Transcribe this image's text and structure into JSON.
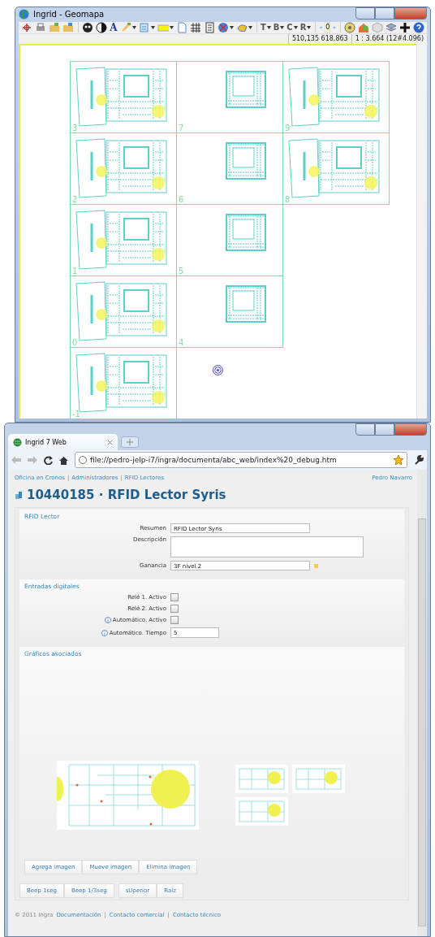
{
  "geomapa_window": {
    "title": "Ingrid - Geomapa",
    "toolbar": {
      "style_letter": "A",
      "letter_tools": [
        {
          "label": "T"
        },
        {
          "label": "B"
        },
        {
          "label": "C"
        },
        {
          "label": "R"
        }
      ],
      "page": "0"
    },
    "status": {
      "coordinates": "510,135  618,863",
      "scale": "1 : 3.664 (12#4.096)"
    },
    "map": {
      "rows": [
        [
          {
            "label": "3",
            "kind": "full"
          },
          {
            "label": "7",
            "kind": "core"
          },
          {
            "label": "9",
            "kind": "full"
          }
        ],
        [
          {
            "label": "2",
            "kind": "full"
          },
          {
            "label": "6",
            "kind": "core"
          },
          {
            "label": "8",
            "kind": "full"
          }
        ],
        [
          {
            "label": "1",
            "kind": "full"
          },
          {
            "label": "5",
            "kind": "core"
          }
        ],
        [
          {
            "label": "0",
            "kind": "full"
          },
          {
            "label": "4",
            "kind": "core"
          }
        ],
        [
          {
            "label": "-1",
            "kind": "full"
          }
        ]
      ]
    }
  },
  "browser_window": {
    "tab": {
      "title": "Ingrid 7 Web"
    },
    "url": "file://pedro-jelp-i7/ingra/documenta/abc_web/index%20_debug.htm",
    "page": {
      "breadcrumb": [
        "Oficina en Cronos",
        "Administradores",
        "RFID Lectores"
      ],
      "breadcrumb_separator": "|",
      "user": "Pedro Navarro",
      "heading": "10440185 · RFID Lector Syris",
      "sections": [
        {
          "title": "RFID Lector",
          "fields": [
            {
              "kind": "text",
              "label": "Resumen",
              "value": "RFID Lector Syris",
              "info": false
            },
            {
              "kind": "textarea",
              "label": "Descripción",
              "info": false
            },
            {
              "kind": "text",
              "label": "Ganancia",
              "value": "3F nivel 2",
              "info": false,
              "marked": true
            }
          ]
        },
        {
          "title": "Entradas digitales",
          "fields": [
            {
              "kind": "checkbox",
              "label": "Relé 1. Activo",
              "checked": false,
              "info": false
            },
            {
              "kind": "checkbox",
              "label": "Relé 2. Activo",
              "checked": false,
              "info": false
            },
            {
              "kind": "checkbox",
              "label": "Automático. Activo",
              "checked": false,
              "info": true
            },
            {
              "kind": "short",
              "label": "Automático. Tiempo",
              "value": "5",
              "info": true
            }
          ]
        }
      ],
      "graphics": {
        "title": "Gráficos asociados",
        "images": [
          {
            "kind": "large"
          },
          {
            "kind": "small"
          },
          {
            "kind": "small"
          },
          {
            "kind": "small"
          }
        ],
        "buttons": [
          "Agrega imagen",
          "Mueve imagen",
          "Elimina imagen"
        ]
      },
      "button_groups": [
        [
          "Beep 1seg",
          "Beep 1/3seg"
        ],
        [
          "sUperior",
          "Raíz"
        ]
      ],
      "footer": {
        "copyright": "© 2011 Ingra",
        "links": [
          "Documentación",
          "Contacto comercial",
          "Contacto técnico"
        ],
        "separator": "|"
      }
    }
  }
}
